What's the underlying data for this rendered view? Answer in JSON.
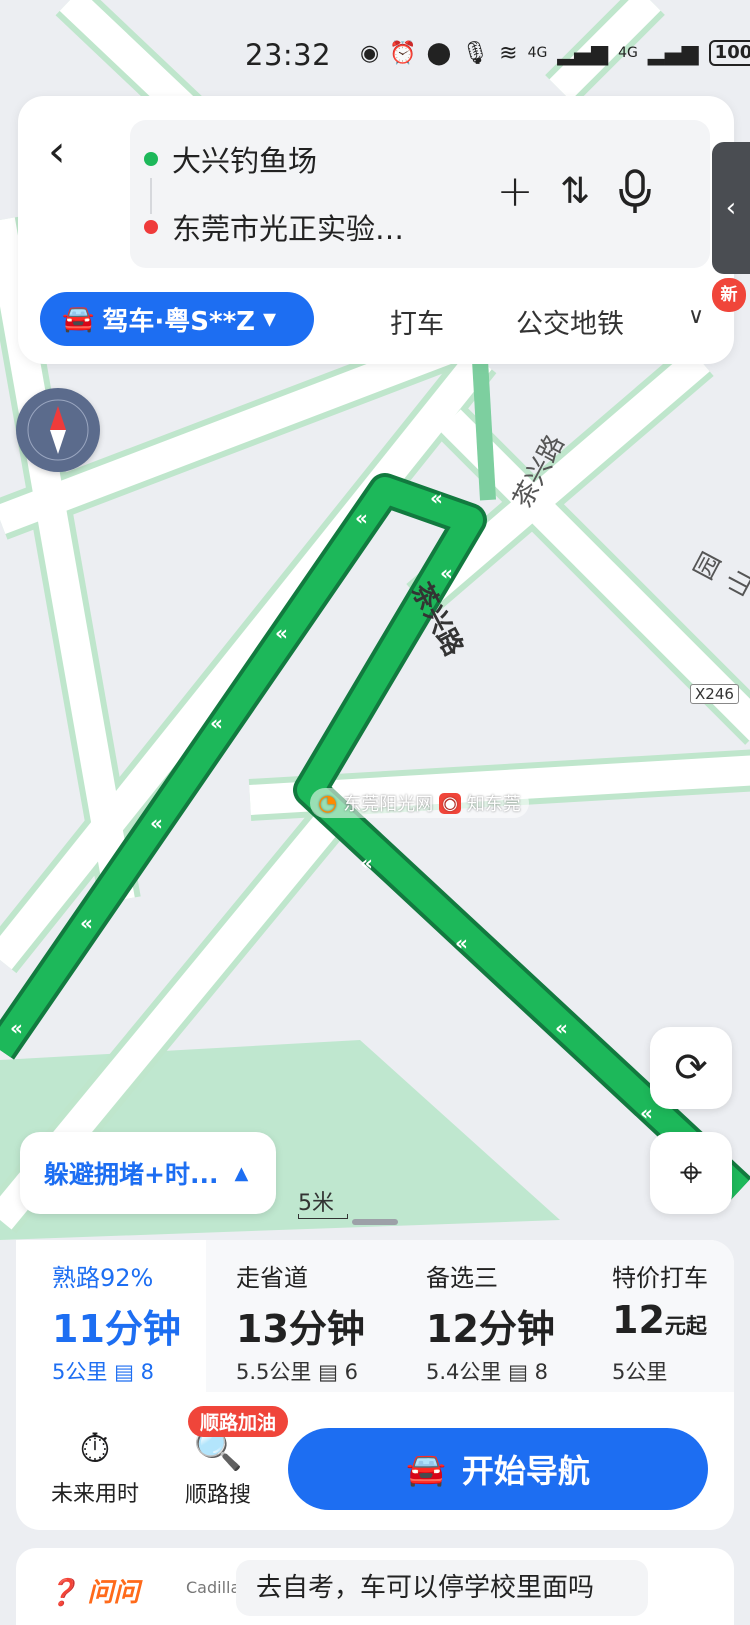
{
  "status_bar": {
    "time": "23:32",
    "battery": "100",
    "signal_label": "4G"
  },
  "route": {
    "start": "大兴钓鱼场",
    "end": "东莞市光正实验…",
    "back_icon": "chevron-left-icon"
  },
  "modes": {
    "active": "驾车·粤S**Z",
    "taxi": "打车",
    "transit": "公交地铁",
    "new_badge": "新"
  },
  "map": {
    "road_name": "茶兴路",
    "road_name_2": "茶兴路",
    "road_name_3": "园山",
    "highway_tag": "X246",
    "watermark_1": "东莞阳光网",
    "watermark_2": "知东莞",
    "scale": "5米"
  },
  "avoid_chip": {
    "label": "躲避拥堵+时..."
  },
  "routes": [
    {
      "label": "熟路92%",
      "time": "11分钟",
      "distance": "5公里",
      "lights": "8",
      "active": true
    },
    {
      "label": "走省道",
      "time": "13分钟",
      "distance": "5.5公里",
      "lights": "6",
      "active": false
    },
    {
      "label": "备选三",
      "time": "12分钟",
      "distance": "5.4公里",
      "lights": "8",
      "active": false
    },
    {
      "label": "特价打车",
      "price": "12",
      "price_unit": "元起",
      "distance": "5公里",
      "active": false
    }
  ],
  "actions": {
    "future": "未来用时",
    "route_search": "顺路搜",
    "fuel_badge": "顺路加油",
    "start_nav": "开始导航"
  },
  "ask": {
    "logo": "问问",
    "brand": "Cadillac",
    "query": "去自考，车可以停学校里面吗"
  },
  "colors": {
    "accent": "#1d6ef2",
    "route_green": "#1db85a",
    "badge_red": "#f0453a"
  }
}
